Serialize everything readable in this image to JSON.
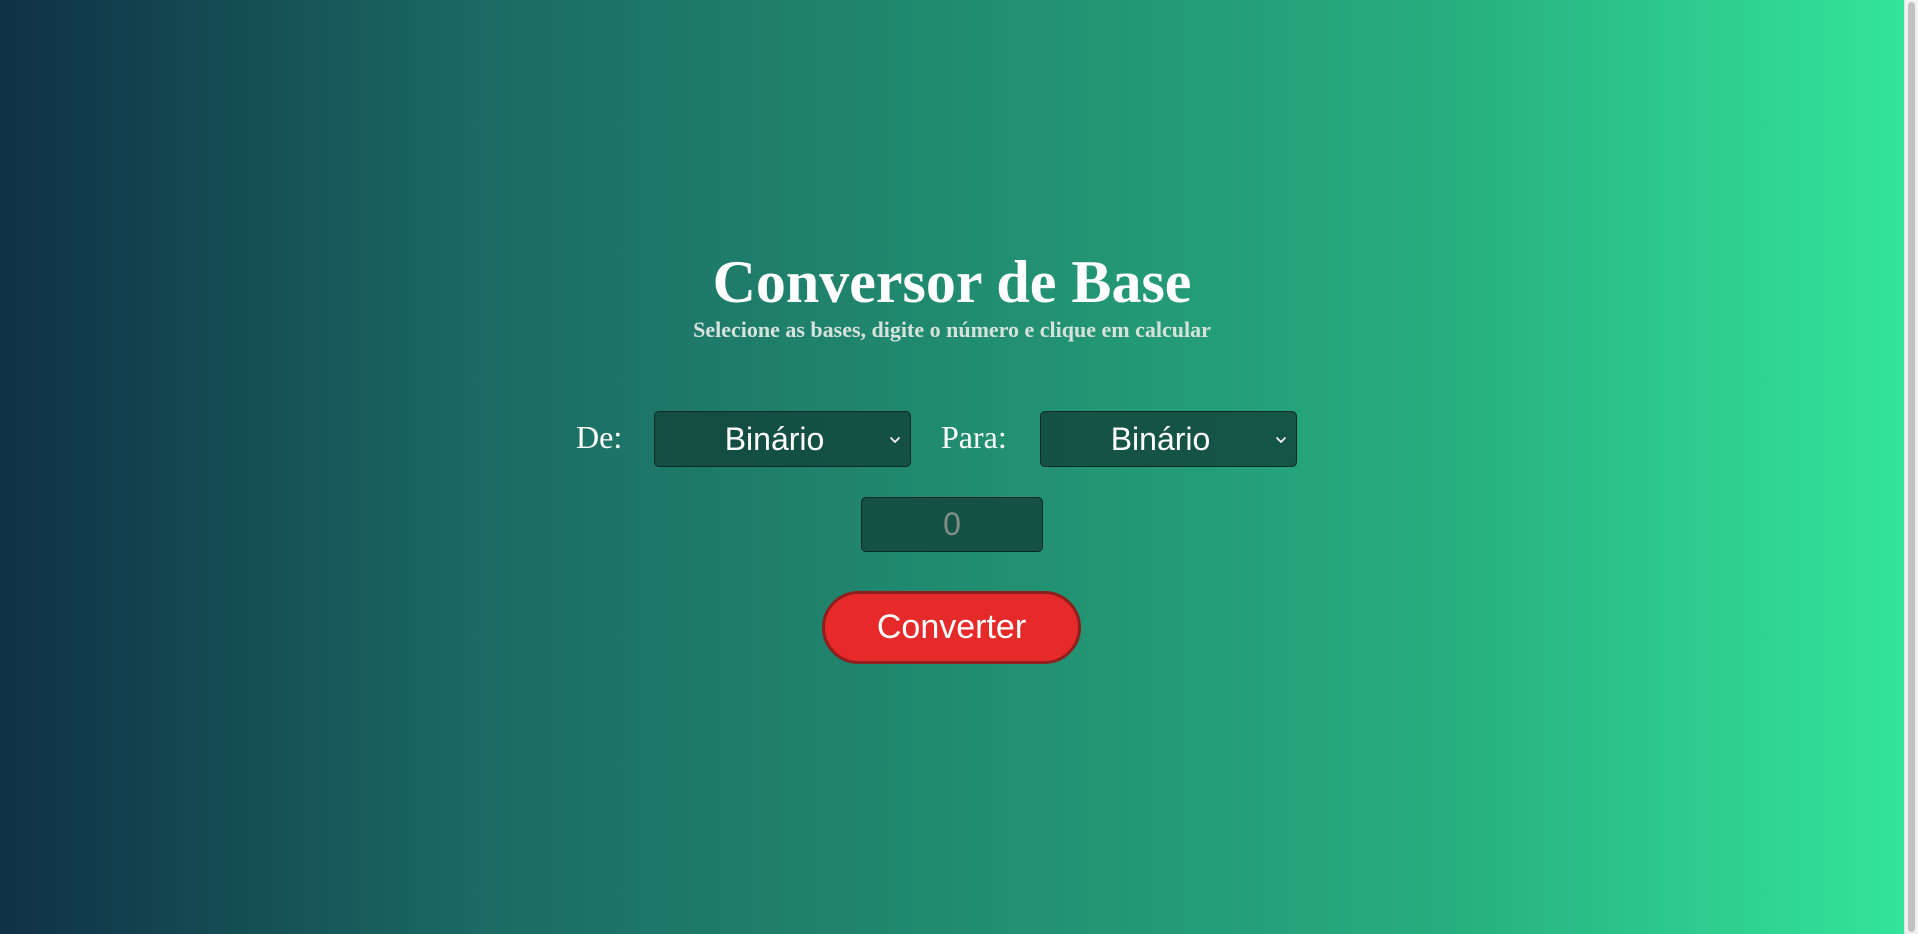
{
  "header": {
    "title": "Conversor de Base",
    "subtitle": "Selecione as bases, digite o número e clique em calcular"
  },
  "form": {
    "from_label": "De:",
    "from_value": "Binário",
    "to_label": "Para:",
    "to_value": "Binário",
    "number_placeholder": "0",
    "convert_label": "Converter"
  },
  "icons": {
    "select_chevron": "chevron-down-icon"
  },
  "colors": {
    "gradient_start": "#0f3146",
    "gradient_end": "#33e69a",
    "button": "#e62a2a",
    "button_border": "#8f1e1e"
  }
}
